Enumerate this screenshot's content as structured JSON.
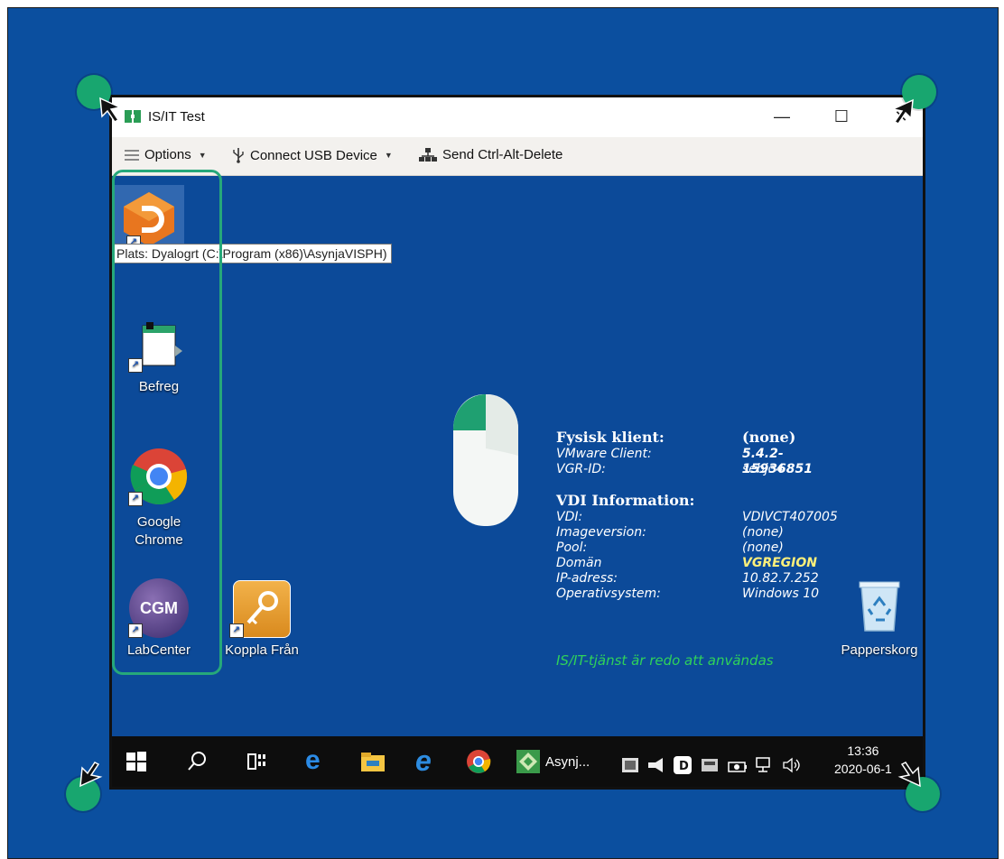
{
  "window": {
    "title": "IS/IT Test",
    "minimize_glyph": "—",
    "maximize_glyph": "☐",
    "close_glyph": "✕"
  },
  "toolbar": {
    "options_label": "Options",
    "usb_label": "Connect USB Device",
    "cad_label": "Send Ctrl-Alt-Delete"
  },
  "desktop": {
    "tooltip": "Plats: Dyalogrt (C:\\Program (x86)\\AsynjaVISPH)",
    "icons": [
      {
        "name": "dyalog",
        "label": ""
      },
      {
        "name": "befreg",
        "label": "Befreg"
      },
      {
        "name": "chrome",
        "label_line1": "Google",
        "label_line2": "Chrome"
      },
      {
        "name": "labcenter",
        "label": "LabCenter",
        "logo_text": "CGM"
      },
      {
        "name": "koppla",
        "label": "Koppla Från"
      },
      {
        "name": "recycle",
        "label": "Papperskorg"
      }
    ]
  },
  "info": {
    "physical_heading": "Fysisk klient:",
    "physical_value": "(none)",
    "rows1": [
      {
        "key": "VMware Client:",
        "value": "5.4.2-15936851"
      },
      {
        "key": "VGR-ID:",
        "value": "sebjo4"
      }
    ],
    "vdi_heading": "VDI Information:",
    "rows2": [
      {
        "key": "VDI:",
        "value": "VDIVCT407005"
      },
      {
        "key": "Imageversion:",
        "value": "(none)"
      },
      {
        "key": "Pool:",
        "value": "(none)"
      },
      {
        "key": "Domän",
        "value": "VGREGION"
      },
      {
        "key": "IP-adress:",
        "value": "10.82.7.252"
      },
      {
        "key": "Operativsystem:",
        "value": "Windows 10"
      }
    ],
    "status": "IS/IT-tjänst är redo att användas"
  },
  "taskbar": {
    "asynja_label": "Asynj...",
    "time": "13:36",
    "date": "2020-06-1"
  },
  "colors": {
    "desktop_bg": "#0c4a99",
    "accent_green": "#18a66f",
    "status_green": "#2fd25a",
    "domain_yellow": "#fff07a"
  }
}
